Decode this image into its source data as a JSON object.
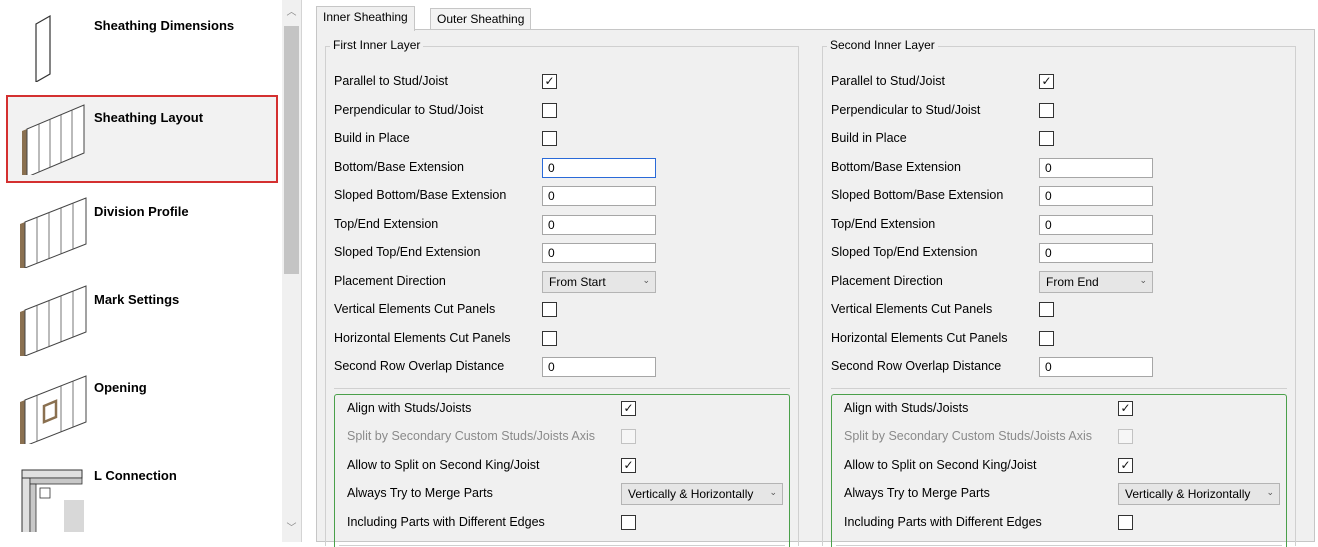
{
  "nav": {
    "items": [
      {
        "label": "Sheathing Dimensions"
      },
      {
        "label": "Sheathing Layout"
      },
      {
        "label": "Division Profile"
      },
      {
        "label": "Mark Settings"
      },
      {
        "label": "Opening"
      },
      {
        "label": "L Connection"
      }
    ],
    "selected_index": 1
  },
  "tabs": [
    {
      "label": "Inner Sheathing",
      "active": true
    },
    {
      "label": "Outer Sheathing",
      "active": false
    }
  ],
  "groups": [
    {
      "title": "First Inner Layer",
      "rows": [
        {
          "label": "Parallel to Stud/Joist",
          "type": "checkbox",
          "checked": true
        },
        {
          "label": "Perpendicular to Stud/Joist",
          "type": "checkbox",
          "checked": false
        },
        {
          "label": "Build in Place",
          "type": "checkbox",
          "checked": false
        },
        {
          "label": "Bottom/Base Extension",
          "type": "text",
          "value": "0",
          "focused": true
        },
        {
          "label": "Sloped Bottom/Base Extension",
          "type": "text",
          "value": "0"
        },
        {
          "label": "Top/End Extension",
          "type": "text",
          "value": "0"
        },
        {
          "label": "Sloped Top/End Extension",
          "type": "text",
          "value": "0"
        },
        {
          "label": "Placement Direction",
          "type": "combo",
          "value": "From Start"
        },
        {
          "label": "Vertical Elements Cut Panels",
          "type": "checkbox",
          "checked": false
        },
        {
          "label": "Horizontal Elements Cut Panels",
          "type": "checkbox",
          "checked": false
        },
        {
          "label": "Second Row Overlap Distance",
          "type": "text",
          "value": "0"
        }
      ],
      "sub_rows": [
        {
          "label": "Align with Studs/Joists",
          "type": "checkbox",
          "checked": true
        },
        {
          "label": "Split by Secondary Custom Studs/Joists Axis",
          "type": "checkbox",
          "checked": false,
          "disabled": true
        },
        {
          "label": "Allow to Split on Second King/Joist",
          "type": "checkbox",
          "checked": true
        },
        {
          "label": "Always Try to Merge Parts",
          "type": "combo",
          "value": "Vertically & Horizontally"
        },
        {
          "label": "Including Parts with Different Edges",
          "type": "checkbox",
          "checked": false
        }
      ]
    },
    {
      "title": "Second Inner Layer",
      "rows": [
        {
          "label": "Parallel to Stud/Joist",
          "type": "checkbox",
          "checked": true
        },
        {
          "label": "Perpendicular to Stud/Joist",
          "type": "checkbox",
          "checked": false
        },
        {
          "label": "Build in Place",
          "type": "checkbox",
          "checked": false
        },
        {
          "label": "Bottom/Base Extension",
          "type": "text",
          "value": "0"
        },
        {
          "label": "Sloped Bottom/Base Extension",
          "type": "text",
          "value": "0"
        },
        {
          "label": "Top/End Extension",
          "type": "text",
          "value": "0"
        },
        {
          "label": "Sloped Top/End Extension",
          "type": "text",
          "value": "0"
        },
        {
          "label": "Placement Direction",
          "type": "combo",
          "value": "From End"
        },
        {
          "label": "Vertical Elements Cut Panels",
          "type": "checkbox",
          "checked": false
        },
        {
          "label": "Horizontal Elements Cut Panels",
          "type": "checkbox",
          "checked": false
        },
        {
          "label": "Second Row Overlap Distance",
          "type": "text",
          "value": "0"
        }
      ],
      "sub_rows": [
        {
          "label": "Align with Studs/Joists",
          "type": "checkbox",
          "checked": true
        },
        {
          "label": "Split by Secondary Custom Studs/Joists Axis",
          "type": "checkbox",
          "checked": false,
          "disabled": true
        },
        {
          "label": "Allow to Split on Second King/Joist",
          "type": "checkbox",
          "checked": true
        },
        {
          "label": "Always Try to Merge Parts",
          "type": "combo",
          "value": "Vertically & Horizontally"
        },
        {
          "label": "Including Parts with Different Edges",
          "type": "checkbox",
          "checked": false
        }
      ]
    }
  ],
  "icons": {
    "check": "check-mark-icon",
    "combo_arrow": "chevron-down-icon",
    "scroll_up": "scroll-up-arrow-icon",
    "scroll_down": "scroll-down-arrow-icon"
  },
  "colors": {
    "selection_border": "#d43030",
    "focus_border": "#2a6ad8",
    "subgroup_border": "#4aa04a",
    "panel_bg": "#f0f0f0",
    "wood": "#8a7050"
  }
}
